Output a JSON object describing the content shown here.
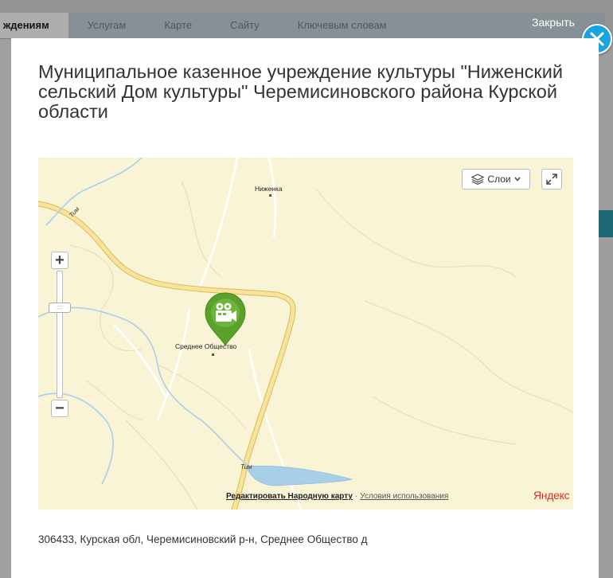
{
  "background": {
    "tabs": [
      "ждениям",
      "Услугам",
      "Карте",
      "Сайту",
      "Ключевым словам"
    ]
  },
  "modal": {
    "close_label": "Закрыть",
    "close_icon": "close-icon",
    "title": "Муниципальное казенное учреждение культуры \"Ниженский сельский Дом культуры\" Черемисиновского района Курской области",
    "address": "306433, Курская обл, Черемисиновский р-н, Среднее Общество д"
  },
  "map": {
    "layers_label": "Слои",
    "places": {
      "nizhenka": "Ниженка",
      "srednee": "Среднее Общество"
    },
    "rivers": {
      "tim_top": "Тим",
      "tim_bottom": "Тим"
    },
    "footer": {
      "edit_link": "Редактировать Народную карту",
      "separator": "·",
      "terms_link": "Условия использования",
      "logo": "Яндекс"
    },
    "colors": {
      "land": "#faf4d6",
      "road": "#f3dc8c",
      "water": "#a9cfe8",
      "pin": "#5aa12a",
      "close_button": "#1aa3dc"
    }
  }
}
